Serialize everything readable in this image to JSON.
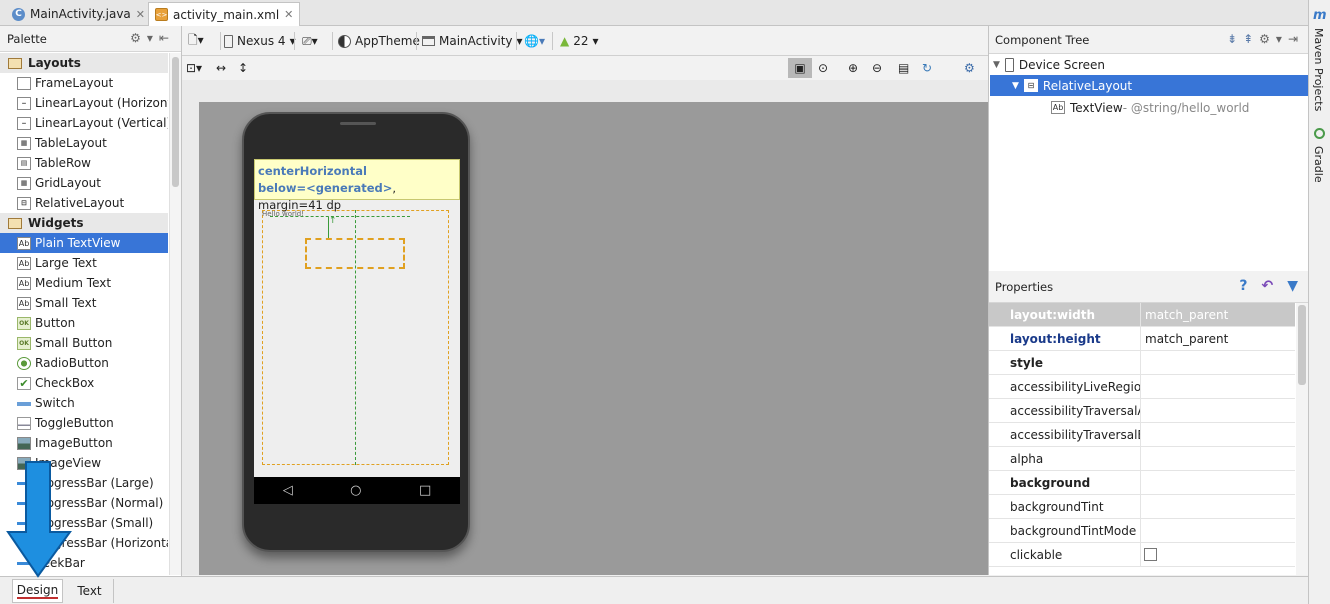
{
  "tabs": [
    {
      "label": "MainActivity.java"
    },
    {
      "label": "activity_main.xml"
    }
  ],
  "palette": {
    "title": "Palette",
    "items": [
      {
        "label": "Layouts",
        "kind": "cat"
      },
      {
        "label": "FrameLayout",
        "icon": "frame-layout-icon"
      },
      {
        "label": "LinearLayout (Horizontal)",
        "icon": "linear-h-icon"
      },
      {
        "label": "LinearLayout (Vertical)",
        "icon": "linear-v-icon"
      },
      {
        "label": "TableLayout",
        "icon": "table-icon"
      },
      {
        "label": "TableRow",
        "icon": "table-row-icon"
      },
      {
        "label": "GridLayout",
        "icon": "grid-icon"
      },
      {
        "label": "RelativeLayout",
        "icon": "relative-icon"
      },
      {
        "label": "Widgets",
        "kind": "cat"
      },
      {
        "label": "Plain TextView",
        "icon": "textview-icon",
        "selected": true
      },
      {
        "label": "Large Text",
        "icon": "textview-icon"
      },
      {
        "label": "Medium Text",
        "icon": "textview-icon"
      },
      {
        "label": "Small Text",
        "icon": "textview-icon"
      },
      {
        "label": "Button",
        "icon": "button-icon"
      },
      {
        "label": "Small Button",
        "icon": "button-icon"
      },
      {
        "label": "RadioButton",
        "icon": "radio-icon"
      },
      {
        "label": "CheckBox",
        "icon": "checkbox-icon"
      },
      {
        "label": "Switch",
        "icon": "switch-icon"
      },
      {
        "label": "ToggleButton",
        "icon": "toggle-icon"
      },
      {
        "label": "ImageButton",
        "icon": "image-button-icon"
      },
      {
        "label": "ImageView",
        "icon": "image-view-icon"
      },
      {
        "label": "ProgressBar (Large)",
        "icon": "progress-icon"
      },
      {
        "label": "ProgressBar (Normal)",
        "icon": "progress-icon"
      },
      {
        "label": "ProgressBar (Small)",
        "icon": "progress-icon"
      },
      {
        "label": "ProgressBar (Horizontal)",
        "icon": "progress-icon"
      },
      {
        "label": "SeekBar",
        "icon": "seekbar-icon"
      }
    ]
  },
  "toolbar": {
    "device": "Nexus 4",
    "theme": "AppTheme",
    "activity": "MainActivity",
    "api": "22"
  },
  "canvas": {
    "tooltip_line1": "centerHorizontal",
    "tooltip_line2_key": "below=<generated>",
    "tooltip_line2_rest": ", margin=41 dp",
    "hello_text": "Hello world!"
  },
  "component_tree": {
    "title": "Component Tree",
    "nodes": [
      {
        "label": "Device Screen"
      },
      {
        "label": "RelativeLayout"
      },
      {
        "label": "TextView",
        "suffix": " - @string/hello_world"
      }
    ]
  },
  "properties": {
    "title": "Properties",
    "rows": [
      {
        "name": "layout:width",
        "value": "match_parent"
      },
      {
        "name": "layout:height",
        "value": "match_parent"
      },
      {
        "name": "style",
        "value": ""
      },
      {
        "name": "accessibilityLiveRegion",
        "value": ""
      },
      {
        "name": "accessibilityTraversalAfter",
        "value": ""
      },
      {
        "name": "accessibilityTraversalBefore",
        "value": ""
      },
      {
        "name": "alpha",
        "value": ""
      },
      {
        "name": "background",
        "value": ""
      },
      {
        "name": "backgroundTint",
        "value": ""
      },
      {
        "name": "backgroundTintMode",
        "value": ""
      },
      {
        "name": "clickable",
        "value": ""
      }
    ]
  },
  "side_tools": [
    "Maven Projects",
    "Gradle"
  ],
  "bottom_tabs": [
    {
      "label": "Design"
    },
    {
      "label": "Text"
    }
  ],
  "colors": {
    "selection": "#3875d7",
    "arrow": "#1e8fe0"
  }
}
